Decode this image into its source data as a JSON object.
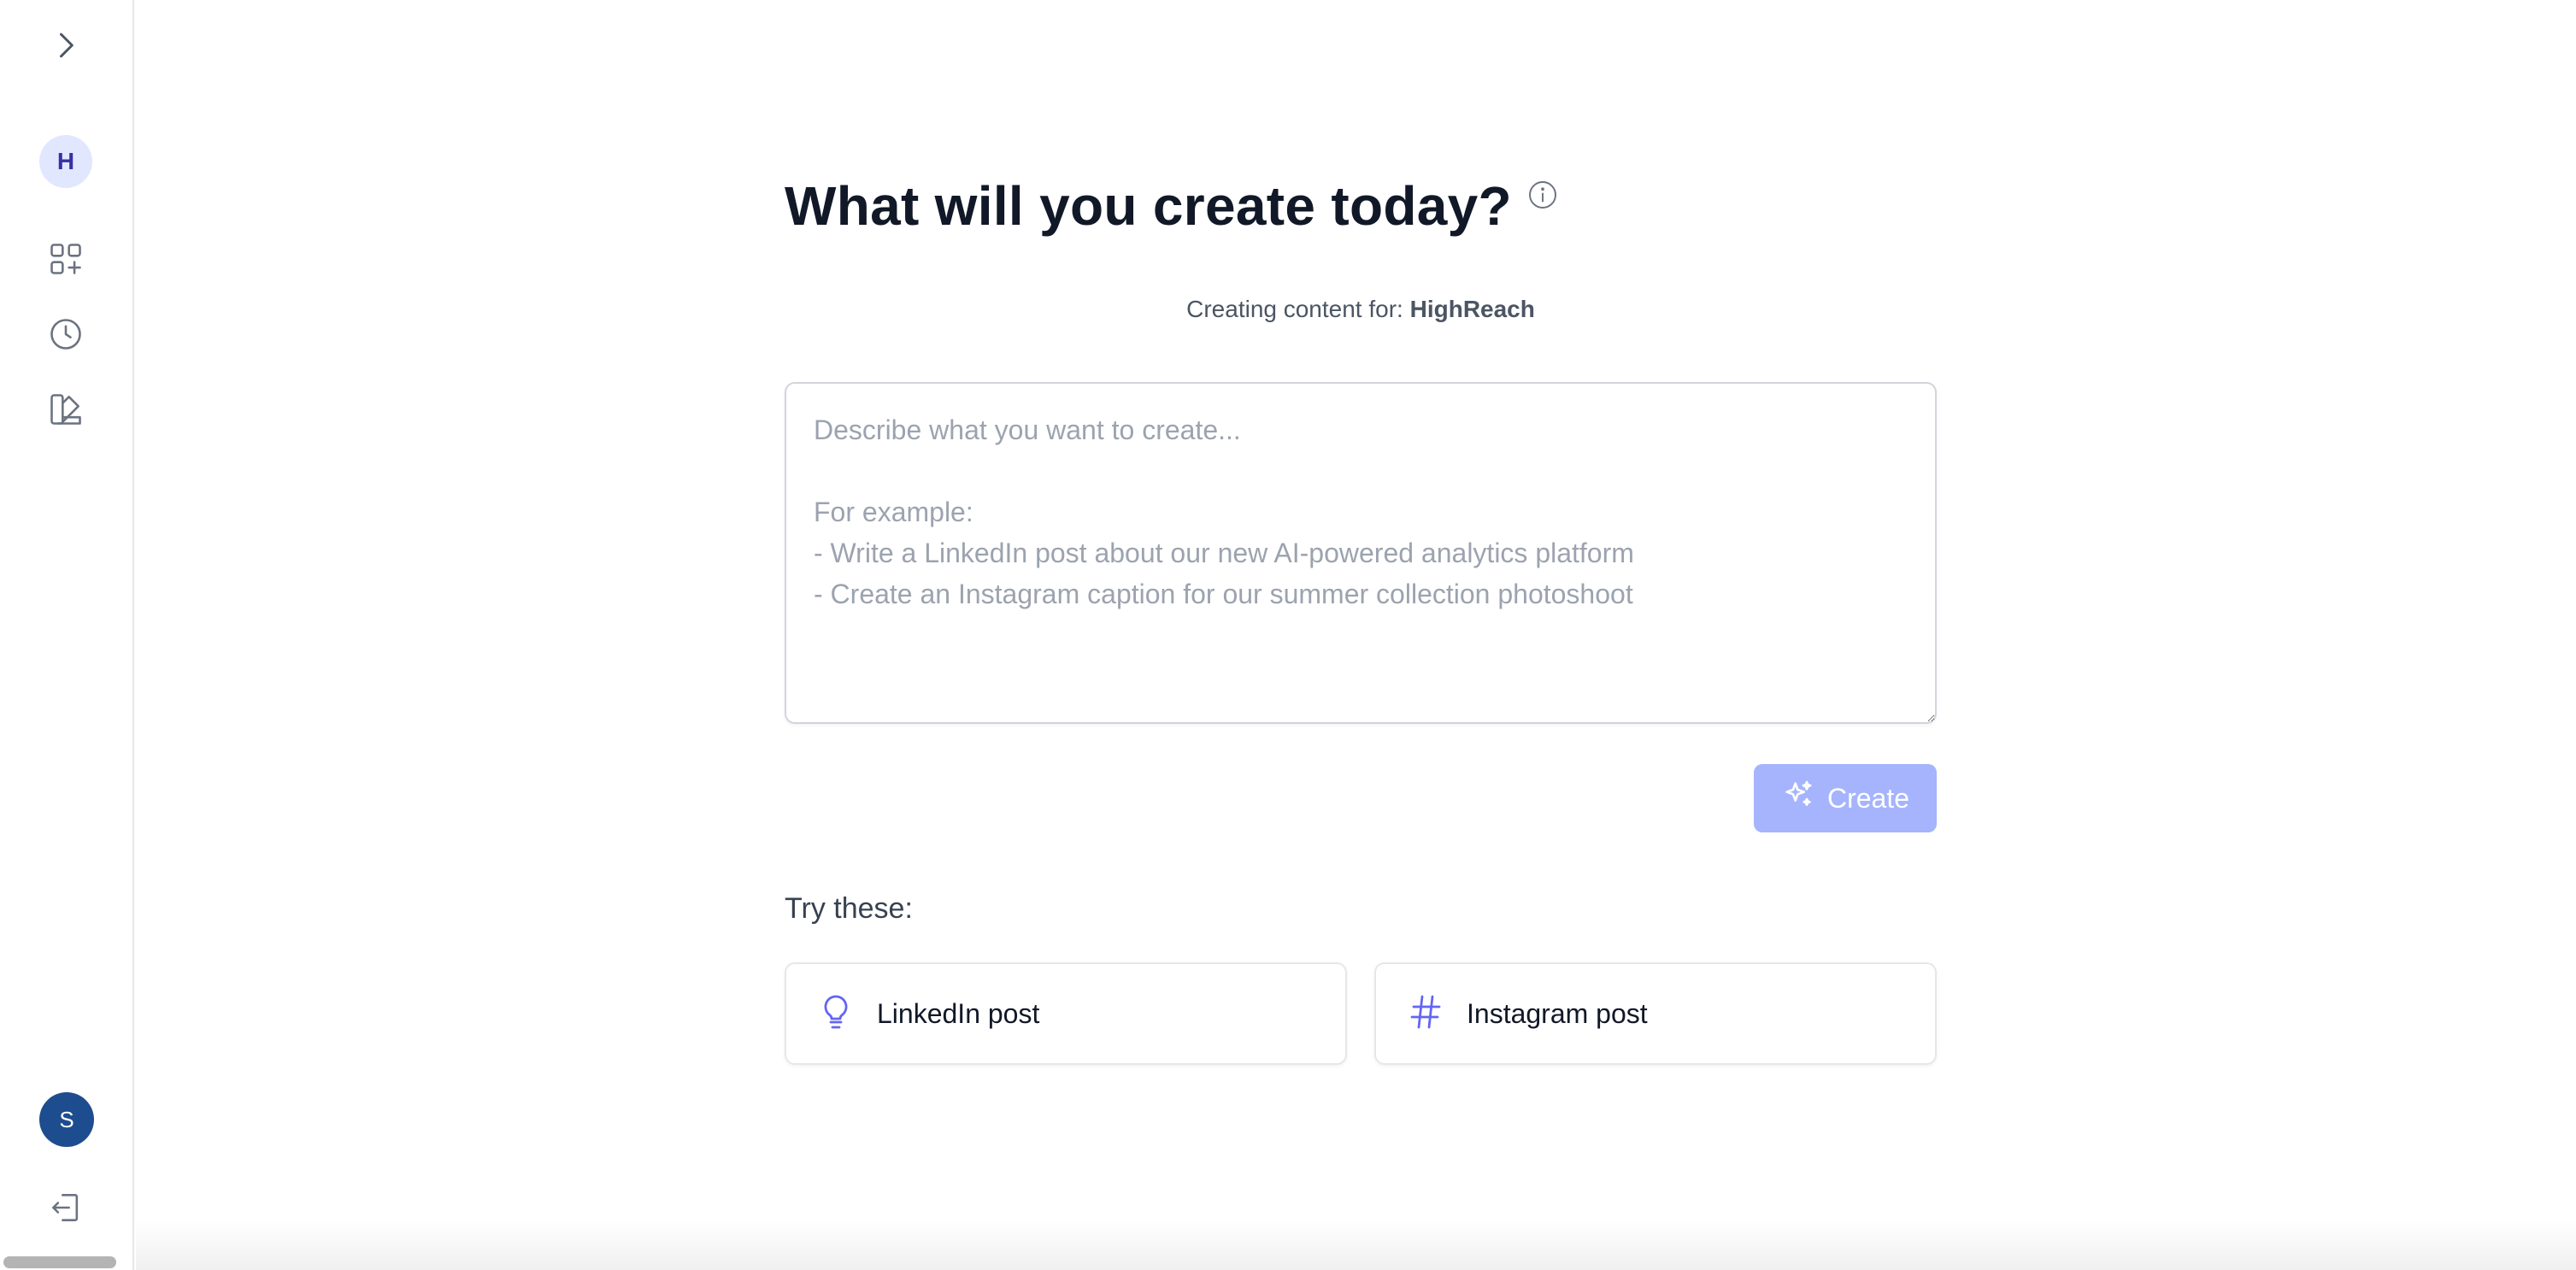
{
  "sidebar": {
    "expand_icon": "chevron-right-icon",
    "workspace_initial": "H",
    "nav_items": [
      {
        "name": "apps",
        "icon": "grid-plus-icon"
      },
      {
        "name": "history",
        "icon": "clock-icon"
      },
      {
        "name": "brand",
        "icon": "palette-icon"
      }
    ],
    "user_initial": "S",
    "logout_icon": "logout-icon"
  },
  "main": {
    "title": "What will you create today?",
    "info_icon": "info-circle-icon",
    "subtitle_prefix": "Creating content for:",
    "subtitle_brand": "HighReach",
    "prompt": {
      "value": "",
      "placeholder": "Describe what you want to create...\n\nFor example:\n- Write a LinkedIn post about our new AI-powered analytics platform\n- Create an Instagram caption for our summer collection photoshoot"
    },
    "create_button": "Create",
    "try_label": "Try these:",
    "suggestions": [
      {
        "label": "LinkedIn post",
        "icon": "lightbulb-icon"
      },
      {
        "label": "Instagram post",
        "icon": "hashtag-icon"
      }
    ]
  },
  "colors": {
    "accent": "#6366f1",
    "create_button_disabled": "#a5b4fc",
    "workspace_avatar_bg": "#e0e7ff",
    "user_avatar_bg": "#1e4d8f"
  }
}
